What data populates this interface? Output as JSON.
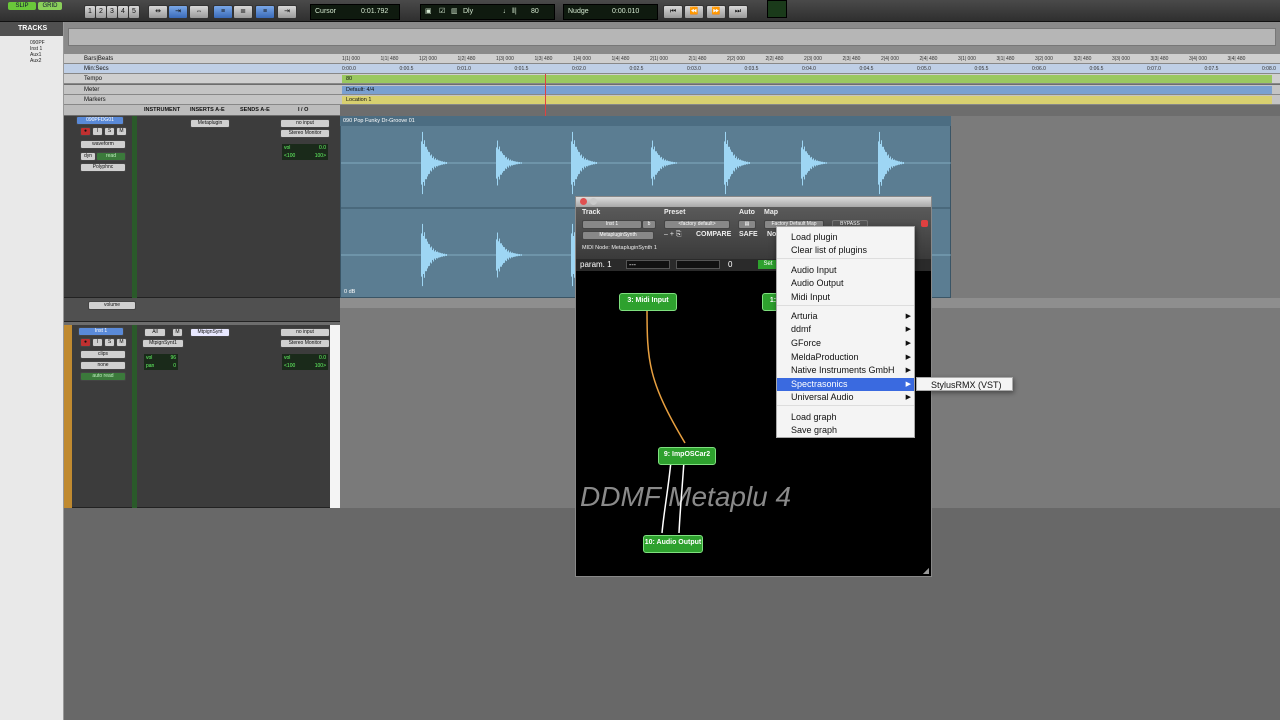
{
  "topbar": {
    "mode_slip": "SLIP",
    "mode_grid": "GRID",
    "tools": [
      "1",
      "2",
      "3",
      "4",
      "5"
    ],
    "cursor_label": "Cursor",
    "cursor_value": "0:01.792",
    "dly_label": "Dly",
    "tempo_value": "80",
    "nudge_label": "Nudge",
    "nudge_value": "0:00.010"
  },
  "tracks_list": {
    "header": "TRACKS",
    "items": [
      "090PF",
      "Inst 1",
      "Aux1",
      "Aux2"
    ]
  },
  "rulers": {
    "bars_label": "Bars|Beats",
    "minsecs_label": "Min:Secs",
    "tempo_label": "Tempo",
    "meter_label": "Meter",
    "markers_label": "Markers",
    "bar_ticks": [
      "1|1| 000",
      "1|1| 480",
      "1|2| 000",
      "1|2| 480",
      "1|3| 000",
      "1|3| 480",
      "1|4| 000",
      "1|4| 480",
      "2|1| 000",
      "2|1| 480",
      "2|2| 000",
      "2|2| 480",
      "2|3| 000",
      "2|3| 480",
      "2|4| 000",
      "2|4| 480",
      "3|1| 000",
      "3|1| 480",
      "3|2| 000",
      "3|2| 480",
      "3|3| 000",
      "3|3| 480",
      "3|4| 000",
      "3|4| 480"
    ],
    "time_ticks": [
      "0:00.0",
      "0:00.5",
      "0:01.0",
      "0:01.5",
      "0:02.0",
      "0:02.5",
      "0:03.0",
      "0:03.5",
      "0:04.0",
      "0:04.5",
      "0:05.0",
      "0:05.5",
      "0:06.0",
      "0:06.5",
      "0:07.0",
      "0:07.5",
      "0:08.0"
    ],
    "tempo_marker": "80",
    "meter_value": "Default: 4/4",
    "location_marker": "Location 1"
  },
  "columns": {
    "instrument": "INSTRUMENT",
    "inserts": "INSERTS A-E",
    "sends": "SENDS A-E",
    "io": "I / O"
  },
  "track1": {
    "name": "090PFDG01",
    "view": "waveform",
    "dyn": "dyn",
    "automation": "read",
    "playlist": "Polyphnc",
    "insert": "Metaplugin",
    "input": "no input",
    "output": "Stereo Monitor",
    "vol": "vol",
    "vol_value": "0.0",
    "pan_left": "<100",
    "pan_right": "100>",
    "region_name": "090 Pop Funky Dr-Groove 01",
    "gain": "0 dB",
    "lane_view": "volume"
  },
  "track2": {
    "name": "Inst 1",
    "view": "clips",
    "automation_mode": "none",
    "automation": "auto read",
    "all_label": "All",
    "m_label": "M",
    "instrument": "MtpignSynt",
    "insert": "MtpignSynt1",
    "input": "no input",
    "output": "Stereo Monitor",
    "vol": "vol",
    "vol_value": "96",
    "pan_label": "pan",
    "pan_value": "0",
    "io_vol_value": "0.0",
    "pan_left": "<100",
    "pan_right": "100>"
  },
  "plugin": {
    "track_label": "Track",
    "preset_label": "Preset",
    "auto_label": "Auto",
    "map_label": "Map",
    "track_value": "Inst 1",
    "track_b": "b",
    "preset_value": "<factory default>",
    "map_value": "Factory Default Map",
    "bypass": "BYPASS",
    "plugin_name": "MetapluginSynth",
    "compare": "COMPARE",
    "safe": "SAFE",
    "native": "No",
    "midi_node": "MIDI Node: MetapluginSynth 1",
    "param_label": "param. 1",
    "param_value": "---",
    "param_num": "0",
    "set_label": "Set",
    "watermark": "DDMF Metaplu                4",
    "nodes": {
      "midi_input": "3: Midi Input",
      "hidden": "1:",
      "synth": "9: ImpOSCar2",
      "audio_output": "10: Audio Output"
    }
  },
  "context_menu": {
    "items": [
      {
        "label": "Load plugin",
        "submenu": false
      },
      {
        "label": "Clear list of plugins",
        "submenu": false
      },
      {
        "label": "Audio Input",
        "submenu": false
      },
      {
        "label": "Audio Output",
        "submenu": false
      },
      {
        "label": "Midi Input",
        "submenu": false
      },
      {
        "label": "Arturia",
        "submenu": true
      },
      {
        "label": "ddmf",
        "submenu": true
      },
      {
        "label": "GForce",
        "submenu": true
      },
      {
        "label": "MeldaProduction",
        "submenu": true
      },
      {
        "label": "Native Instruments GmbH",
        "submenu": true
      },
      {
        "label": "Spectrasonics",
        "submenu": true,
        "selected": true
      },
      {
        "label": "Universal Audio",
        "submenu": true
      },
      {
        "label": "Load graph",
        "submenu": false
      },
      {
        "label": "Save graph",
        "submenu": false
      }
    ],
    "submenu_item": "StylusRMX (VST)",
    "arrow_glyph": "▶"
  },
  "colors": {
    "accent_blue": "#3a6ae0",
    "node_green": "#2ea12e",
    "waveform": "#8fd0f0",
    "midi_cable": "#e8a040"
  }
}
